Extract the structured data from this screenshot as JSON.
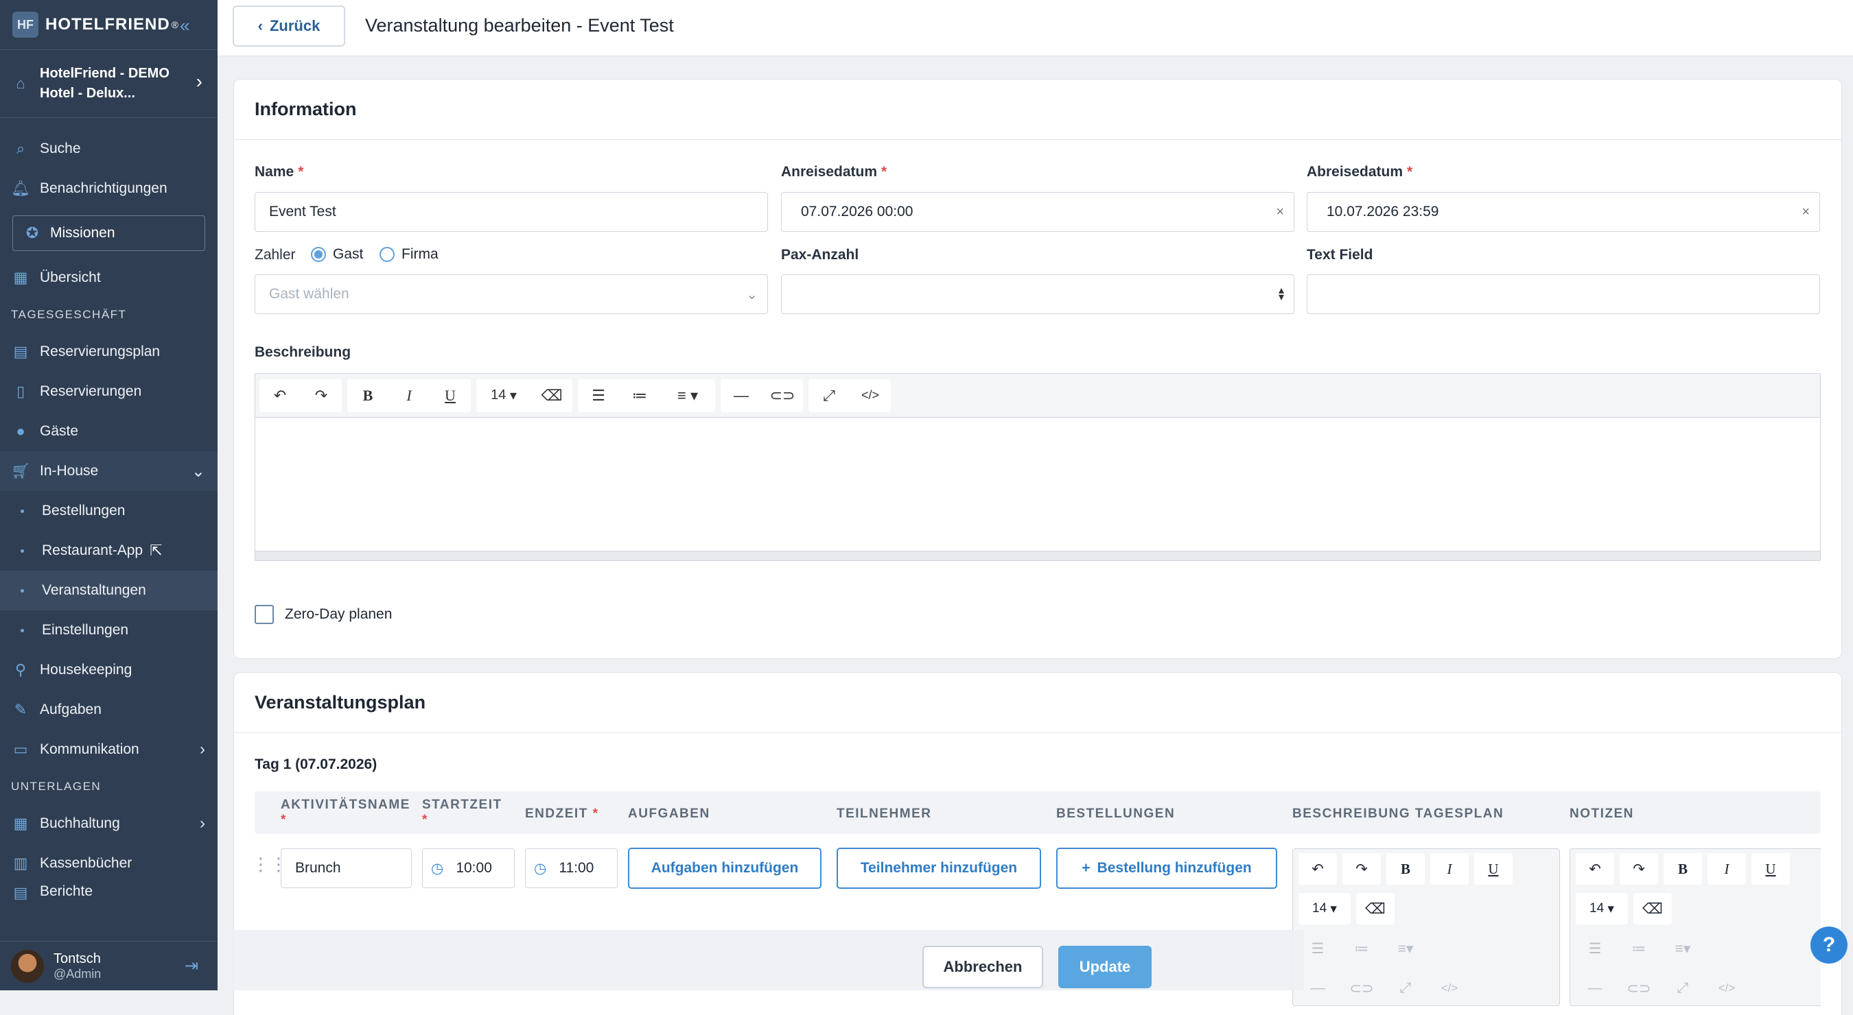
{
  "brand": {
    "logo_mark": "HF",
    "name": "HOTELFRIEND",
    "reg": "®"
  },
  "hotel": {
    "line1": "HotelFriend - DEMO",
    "line2": "Hotel - Delux..."
  },
  "nav": {
    "search": "Suche",
    "notifications": "Benachrichtigungen",
    "missions": "Missionen",
    "overview": "Übersicht",
    "section_daily": "TAGESGESCHÄFT",
    "reservation_plan": "Reservierungsplan",
    "reservations": "Reservierungen",
    "guests": "Gäste",
    "inhouse": "In-House",
    "orders": "Bestellungen",
    "restaurant_app": "Restaurant-App",
    "events": "Veranstaltungen",
    "settings": "Einstellungen",
    "housekeeping": "Housekeeping",
    "tasks": "Aufgaben",
    "communication": "Kommunikation",
    "section_docs": "UNTERLAGEN",
    "accounting": "Buchhaltung",
    "cashbooks": "Kassenbücher",
    "partial": "Berichte"
  },
  "user": {
    "name": "Tontsch",
    "role": "@Admin"
  },
  "topbar": {
    "back_label": "Zurück",
    "title": "Veranstaltung bearbeiten - Event Test"
  },
  "info": {
    "title": "Information",
    "name_label": "Name",
    "name_value": "Event Test",
    "arrival_label": "Anreisedatum",
    "arrival_value": "07.07.2026 00:00",
    "departure_label": "Abreisedatum",
    "departure_value": "10.07.2026 23:59",
    "payer_label": "Zahler",
    "payer_options": [
      "Gast",
      "Firma"
    ],
    "payer_selected": "Gast",
    "guest_placeholder": "Gast wählen",
    "pax_label": "Pax-Anzahl",
    "pax_value": "",
    "text_field_label": "Text Field",
    "text_field_value": "",
    "description_label": "Beschreibung",
    "font_size": "14",
    "zero_day_label": "Zero-Day planen",
    "zero_day_checked": false
  },
  "plan": {
    "title": "Veranstaltungsplan",
    "day_label": "Tag 1 (07.07.2026)",
    "columns": [
      "AKTIVITÄTSNAME",
      "STARTZEIT",
      "ENDZEIT",
      "AUFGABEN",
      "TEILNEHMER",
      "BESTELLUNGEN",
      "BESCHREIBUNG TAGESPLAN",
      "NOTIZEN"
    ],
    "row": {
      "activity": "Brunch",
      "start": "10:00",
      "end": "11:00",
      "tasks_btn": "Aufgaben hinzufügen",
      "participants_btn": "Teilnehmer hinzufügen",
      "orders_btn": "Bestellung hinzufügen",
      "font_size": "14"
    }
  },
  "footer": {
    "cancel": "Abbrechen",
    "update": "Update"
  },
  "help": "?",
  "colors": {
    "sidebar": "#2f3e52",
    "accent": "#3d8bd6",
    "update": "#5aa6e0",
    "required": "#e04b4b"
  }
}
